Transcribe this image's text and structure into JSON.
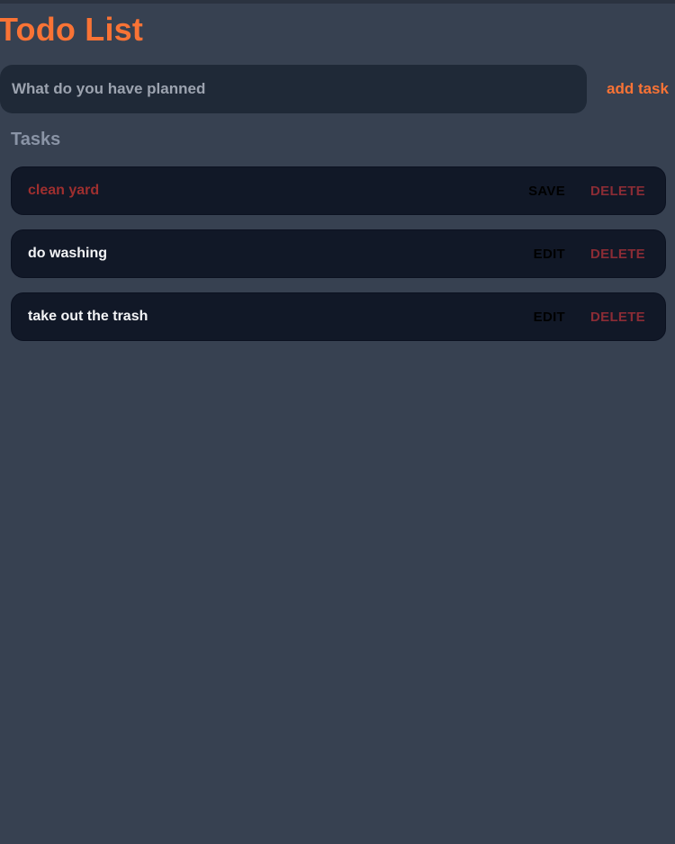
{
  "header": {
    "title": "Todo List"
  },
  "new_task": {
    "placeholder": "What do you have planned",
    "value": "",
    "submit_label": "add task"
  },
  "tasks_section": {
    "heading": "Tasks",
    "items": [
      {
        "text": "clean yard",
        "editing": true,
        "primary_action": "SAVE",
        "delete_action": "DELETE"
      },
      {
        "text": "do washing",
        "editing": false,
        "primary_action": "EDIT",
        "delete_action": "DELETE"
      },
      {
        "text": "take out the trash",
        "editing": false,
        "primary_action": "EDIT",
        "delete_action": "DELETE"
      }
    ]
  },
  "colors": {
    "background": "#374151",
    "accent": "#f97335",
    "card": "#111827",
    "input": "#1f2937",
    "danger": "#8b2c35",
    "editing_text": "#9f2f2f"
  }
}
